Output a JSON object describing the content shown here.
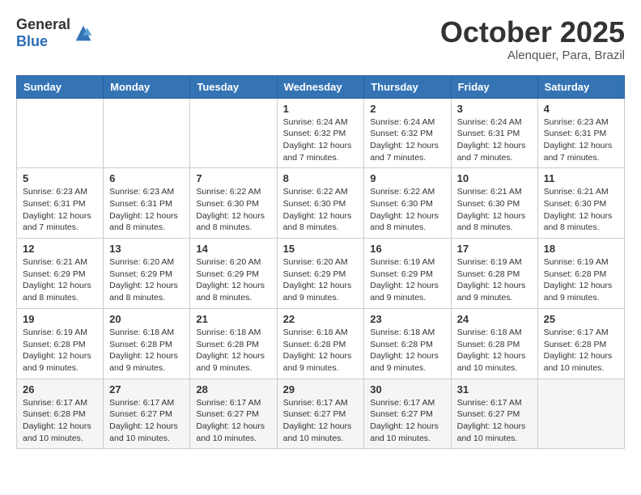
{
  "header": {
    "logo_general": "General",
    "logo_blue": "Blue",
    "month": "October 2025",
    "location": "Alenquer, Para, Brazil"
  },
  "days_of_week": [
    "Sunday",
    "Monday",
    "Tuesday",
    "Wednesday",
    "Thursday",
    "Friday",
    "Saturday"
  ],
  "weeks": [
    [
      {
        "day": "",
        "content": ""
      },
      {
        "day": "",
        "content": ""
      },
      {
        "day": "",
        "content": ""
      },
      {
        "day": "1",
        "content": "Sunrise: 6:24 AM\nSunset: 6:32 PM\nDaylight: 12 hours\nand 7 minutes."
      },
      {
        "day": "2",
        "content": "Sunrise: 6:24 AM\nSunset: 6:32 PM\nDaylight: 12 hours\nand 7 minutes."
      },
      {
        "day": "3",
        "content": "Sunrise: 6:24 AM\nSunset: 6:31 PM\nDaylight: 12 hours\nand 7 minutes."
      },
      {
        "day": "4",
        "content": "Sunrise: 6:23 AM\nSunset: 6:31 PM\nDaylight: 12 hours\nand 7 minutes."
      }
    ],
    [
      {
        "day": "5",
        "content": "Sunrise: 6:23 AM\nSunset: 6:31 PM\nDaylight: 12 hours\nand 7 minutes."
      },
      {
        "day": "6",
        "content": "Sunrise: 6:23 AM\nSunset: 6:31 PM\nDaylight: 12 hours\nand 8 minutes."
      },
      {
        "day": "7",
        "content": "Sunrise: 6:22 AM\nSunset: 6:30 PM\nDaylight: 12 hours\nand 8 minutes."
      },
      {
        "day": "8",
        "content": "Sunrise: 6:22 AM\nSunset: 6:30 PM\nDaylight: 12 hours\nand 8 minutes."
      },
      {
        "day": "9",
        "content": "Sunrise: 6:22 AM\nSunset: 6:30 PM\nDaylight: 12 hours\nand 8 minutes."
      },
      {
        "day": "10",
        "content": "Sunrise: 6:21 AM\nSunset: 6:30 PM\nDaylight: 12 hours\nand 8 minutes."
      },
      {
        "day": "11",
        "content": "Sunrise: 6:21 AM\nSunset: 6:30 PM\nDaylight: 12 hours\nand 8 minutes."
      }
    ],
    [
      {
        "day": "12",
        "content": "Sunrise: 6:21 AM\nSunset: 6:29 PM\nDaylight: 12 hours\nand 8 minutes."
      },
      {
        "day": "13",
        "content": "Sunrise: 6:20 AM\nSunset: 6:29 PM\nDaylight: 12 hours\nand 8 minutes."
      },
      {
        "day": "14",
        "content": "Sunrise: 6:20 AM\nSunset: 6:29 PM\nDaylight: 12 hours\nand 8 minutes."
      },
      {
        "day": "15",
        "content": "Sunrise: 6:20 AM\nSunset: 6:29 PM\nDaylight: 12 hours\nand 9 minutes."
      },
      {
        "day": "16",
        "content": "Sunrise: 6:19 AM\nSunset: 6:29 PM\nDaylight: 12 hours\nand 9 minutes."
      },
      {
        "day": "17",
        "content": "Sunrise: 6:19 AM\nSunset: 6:28 PM\nDaylight: 12 hours\nand 9 minutes."
      },
      {
        "day": "18",
        "content": "Sunrise: 6:19 AM\nSunset: 6:28 PM\nDaylight: 12 hours\nand 9 minutes."
      }
    ],
    [
      {
        "day": "19",
        "content": "Sunrise: 6:19 AM\nSunset: 6:28 PM\nDaylight: 12 hours\nand 9 minutes."
      },
      {
        "day": "20",
        "content": "Sunrise: 6:18 AM\nSunset: 6:28 PM\nDaylight: 12 hours\nand 9 minutes."
      },
      {
        "day": "21",
        "content": "Sunrise: 6:18 AM\nSunset: 6:28 PM\nDaylight: 12 hours\nand 9 minutes."
      },
      {
        "day": "22",
        "content": "Sunrise: 6:18 AM\nSunset: 6:28 PM\nDaylight: 12 hours\nand 9 minutes."
      },
      {
        "day": "23",
        "content": "Sunrise: 6:18 AM\nSunset: 6:28 PM\nDaylight: 12 hours\nand 9 minutes."
      },
      {
        "day": "24",
        "content": "Sunrise: 6:18 AM\nSunset: 6:28 PM\nDaylight: 12 hours\nand 10 minutes."
      },
      {
        "day": "25",
        "content": "Sunrise: 6:17 AM\nSunset: 6:28 PM\nDaylight: 12 hours\nand 10 minutes."
      }
    ],
    [
      {
        "day": "26",
        "content": "Sunrise: 6:17 AM\nSunset: 6:28 PM\nDaylight: 12 hours\nand 10 minutes."
      },
      {
        "day": "27",
        "content": "Sunrise: 6:17 AM\nSunset: 6:27 PM\nDaylight: 12 hours\nand 10 minutes."
      },
      {
        "day": "28",
        "content": "Sunrise: 6:17 AM\nSunset: 6:27 PM\nDaylight: 12 hours\nand 10 minutes."
      },
      {
        "day": "29",
        "content": "Sunrise: 6:17 AM\nSunset: 6:27 PM\nDaylight: 12 hours\nand 10 minutes."
      },
      {
        "day": "30",
        "content": "Sunrise: 6:17 AM\nSunset: 6:27 PM\nDaylight: 12 hours\nand 10 minutes."
      },
      {
        "day": "31",
        "content": "Sunrise: 6:17 AM\nSunset: 6:27 PM\nDaylight: 12 hours\nand 10 minutes."
      },
      {
        "day": "",
        "content": ""
      }
    ]
  ]
}
